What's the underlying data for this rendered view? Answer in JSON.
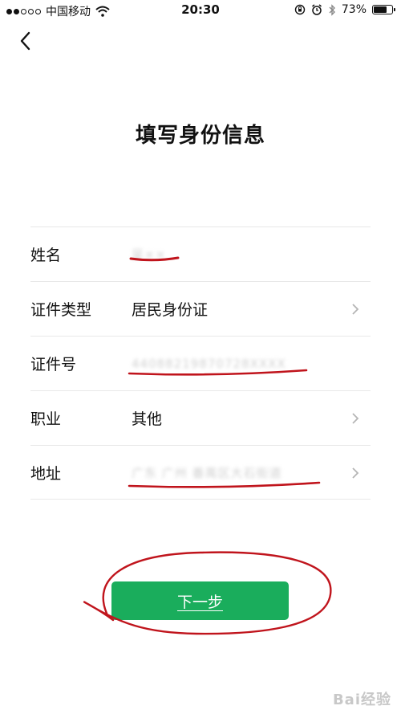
{
  "status_bar": {
    "carrier": "中国移动",
    "time": "20:30",
    "battery": "73%",
    "battery_level": 0.73
  },
  "page": {
    "title": "填写身份信息"
  },
  "form": {
    "rows": [
      {
        "label": "姓名",
        "value": "吴××"
      },
      {
        "label": "证件类型",
        "value": "居民身份证"
      },
      {
        "label": "证件号",
        "value": "44088219870728XXXX"
      },
      {
        "label": "职业",
        "value": "其他"
      },
      {
        "label": "地址",
        "value": "广东 广州 番禺区大石街道"
      }
    ]
  },
  "actions": {
    "next_label": "下一步"
  },
  "watermark": "Bai经验",
  "colors": {
    "primary_button": "#1aad5c",
    "annotation_ink": "#c0141c"
  }
}
